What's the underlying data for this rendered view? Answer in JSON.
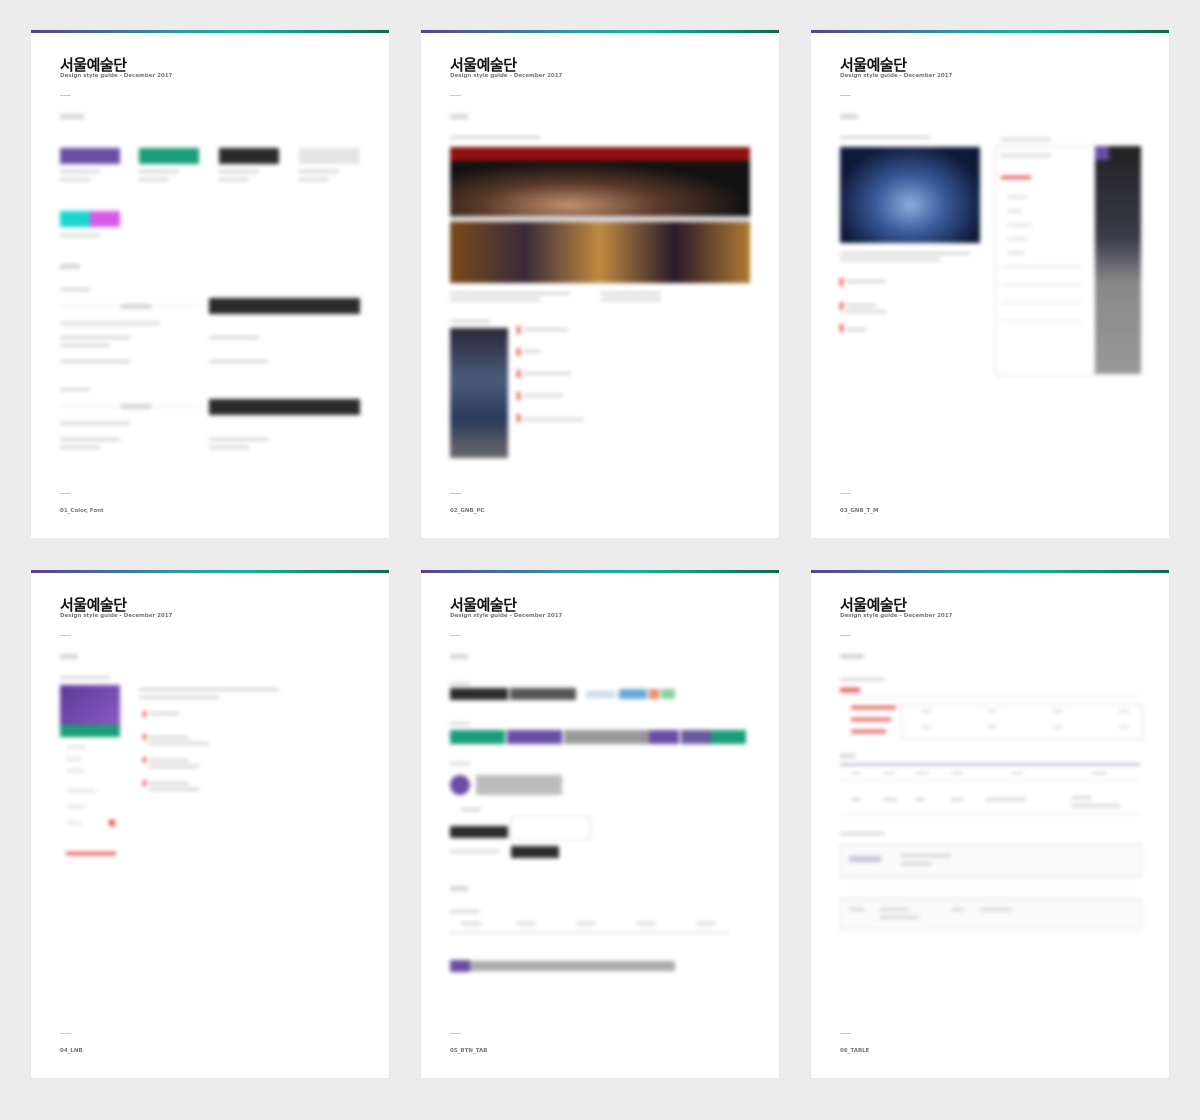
{
  "brand": "서울예술단",
  "subtitle": "Design style guide - December 2017",
  "pages": [
    {
      "label": "01_Color, Font"
    },
    {
      "label": "02_GNB_PC"
    },
    {
      "label": "03_GNB_T_M"
    },
    {
      "label": "04_LNB"
    },
    {
      "label": "05_BTN_TAB"
    },
    {
      "label": "06_TABLE"
    }
  ],
  "colors": {
    "background": "#ececec",
    "accent_purple": "#6a4ea5",
    "accent_green": "#1a9d78",
    "accent_cyan": "#19d6d0",
    "accent_magenta": "#d85ae8",
    "accent_red": "#e04848",
    "dark": "#2b2b2b"
  }
}
